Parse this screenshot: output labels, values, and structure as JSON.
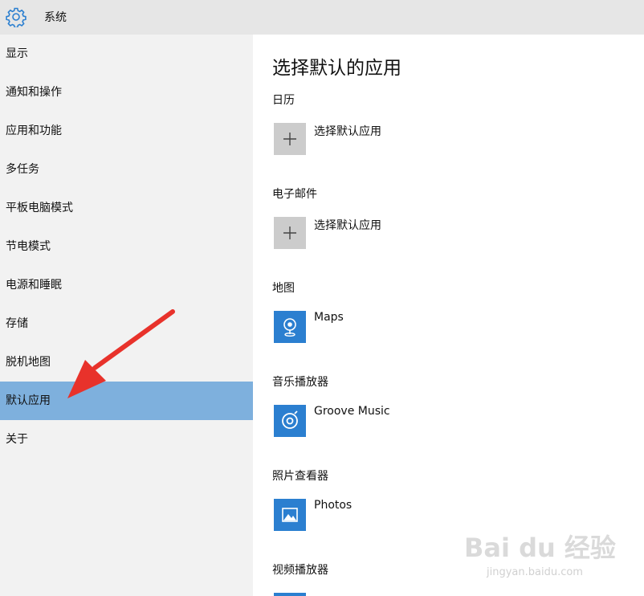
{
  "window": {
    "title": "系统",
    "icon": "gear-icon"
  },
  "sidebar": {
    "items": [
      {
        "label": "显示"
      },
      {
        "label": "通知和操作"
      },
      {
        "label": "应用和功能"
      },
      {
        "label": "多任务"
      },
      {
        "label": "平板电脑模式"
      },
      {
        "label": "节电模式"
      },
      {
        "label": "电源和睡眠"
      },
      {
        "label": "存储"
      },
      {
        "label": "脱机地图"
      },
      {
        "label": "默认应用",
        "selected": true
      },
      {
        "label": "关于"
      }
    ]
  },
  "main": {
    "title": "选择默认的应用",
    "sections": [
      {
        "label": "日历",
        "app": "选择默认应用",
        "icon": "plus-icon"
      },
      {
        "label": "电子邮件",
        "app": "选择默认应用",
        "icon": "plus-icon"
      },
      {
        "label": "地图",
        "app": "Maps",
        "icon": "maps-icon"
      },
      {
        "label": "音乐播放器",
        "app": "Groove Music",
        "icon": "groove-music-icon"
      },
      {
        "label": "照片查看器",
        "app": "Photos",
        "icon": "photos-icon"
      },
      {
        "label": "视频播放器",
        "app": "",
        "icon": "video-icon"
      }
    ]
  },
  "colors": {
    "accent": "#2b7fd0",
    "selected_nav": "#7eb0dd",
    "sidebar_bg": "#f2f2f2",
    "titlebar_bg": "#e6e6e6",
    "annotation_arrow": "#e8322b"
  },
  "watermark": {
    "main": "Bai du 经验",
    "sub": "jingyan.baidu.com"
  }
}
